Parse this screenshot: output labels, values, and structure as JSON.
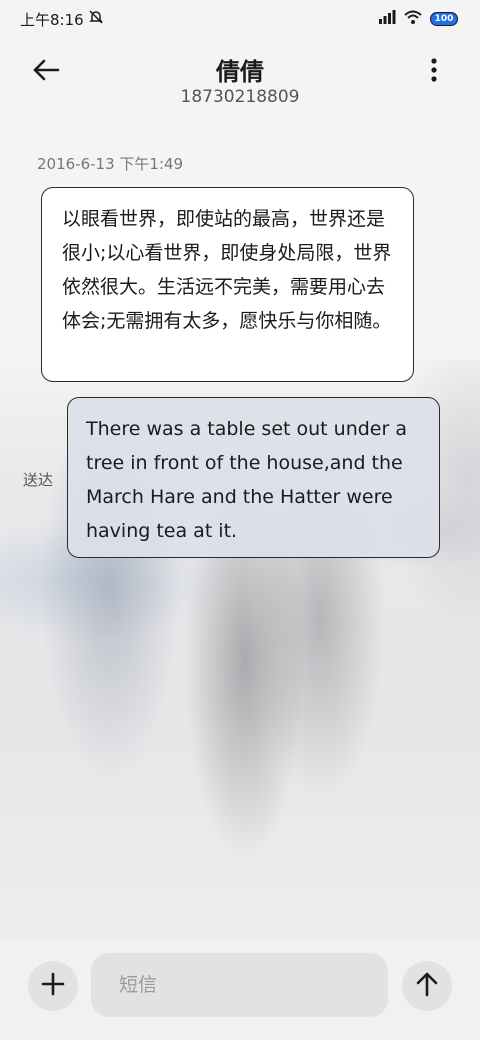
{
  "status_bar": {
    "time": "上午8:16",
    "battery": "100"
  },
  "header": {
    "contact_name": "倩倩",
    "contact_number": "18730218809"
  },
  "conversation": {
    "timestamp": "2016-6-13 下午1:49",
    "messages": [
      {
        "direction": "incoming",
        "text": "以眼看世界，即使站的最高，世界还是很小;以心看世界，即使身处局限，世界依然很大。生活远不完美，需要用心去体会;无需拥有太多，愿快乐与你相随。"
      },
      {
        "direction": "outgoing",
        "text": "There was a table set out under a tree in front of the house,and the March Hare and the Hatter were having tea at it.",
        "status": "送达"
      }
    ]
  },
  "composer": {
    "placeholder": "短信"
  },
  "icons": {
    "back": "arrow-left-icon",
    "more": "more-vertical-icon",
    "add": "plus-icon",
    "send": "arrow-up-icon",
    "wifi": "wifi-icon",
    "signal": "signal-icon",
    "dnd": "notification-off-icon"
  },
  "colors": {
    "battery": "#1f6feb",
    "outgoing_bubble": "#dce0e8",
    "incoming_bubble": "#ffffff"
  }
}
